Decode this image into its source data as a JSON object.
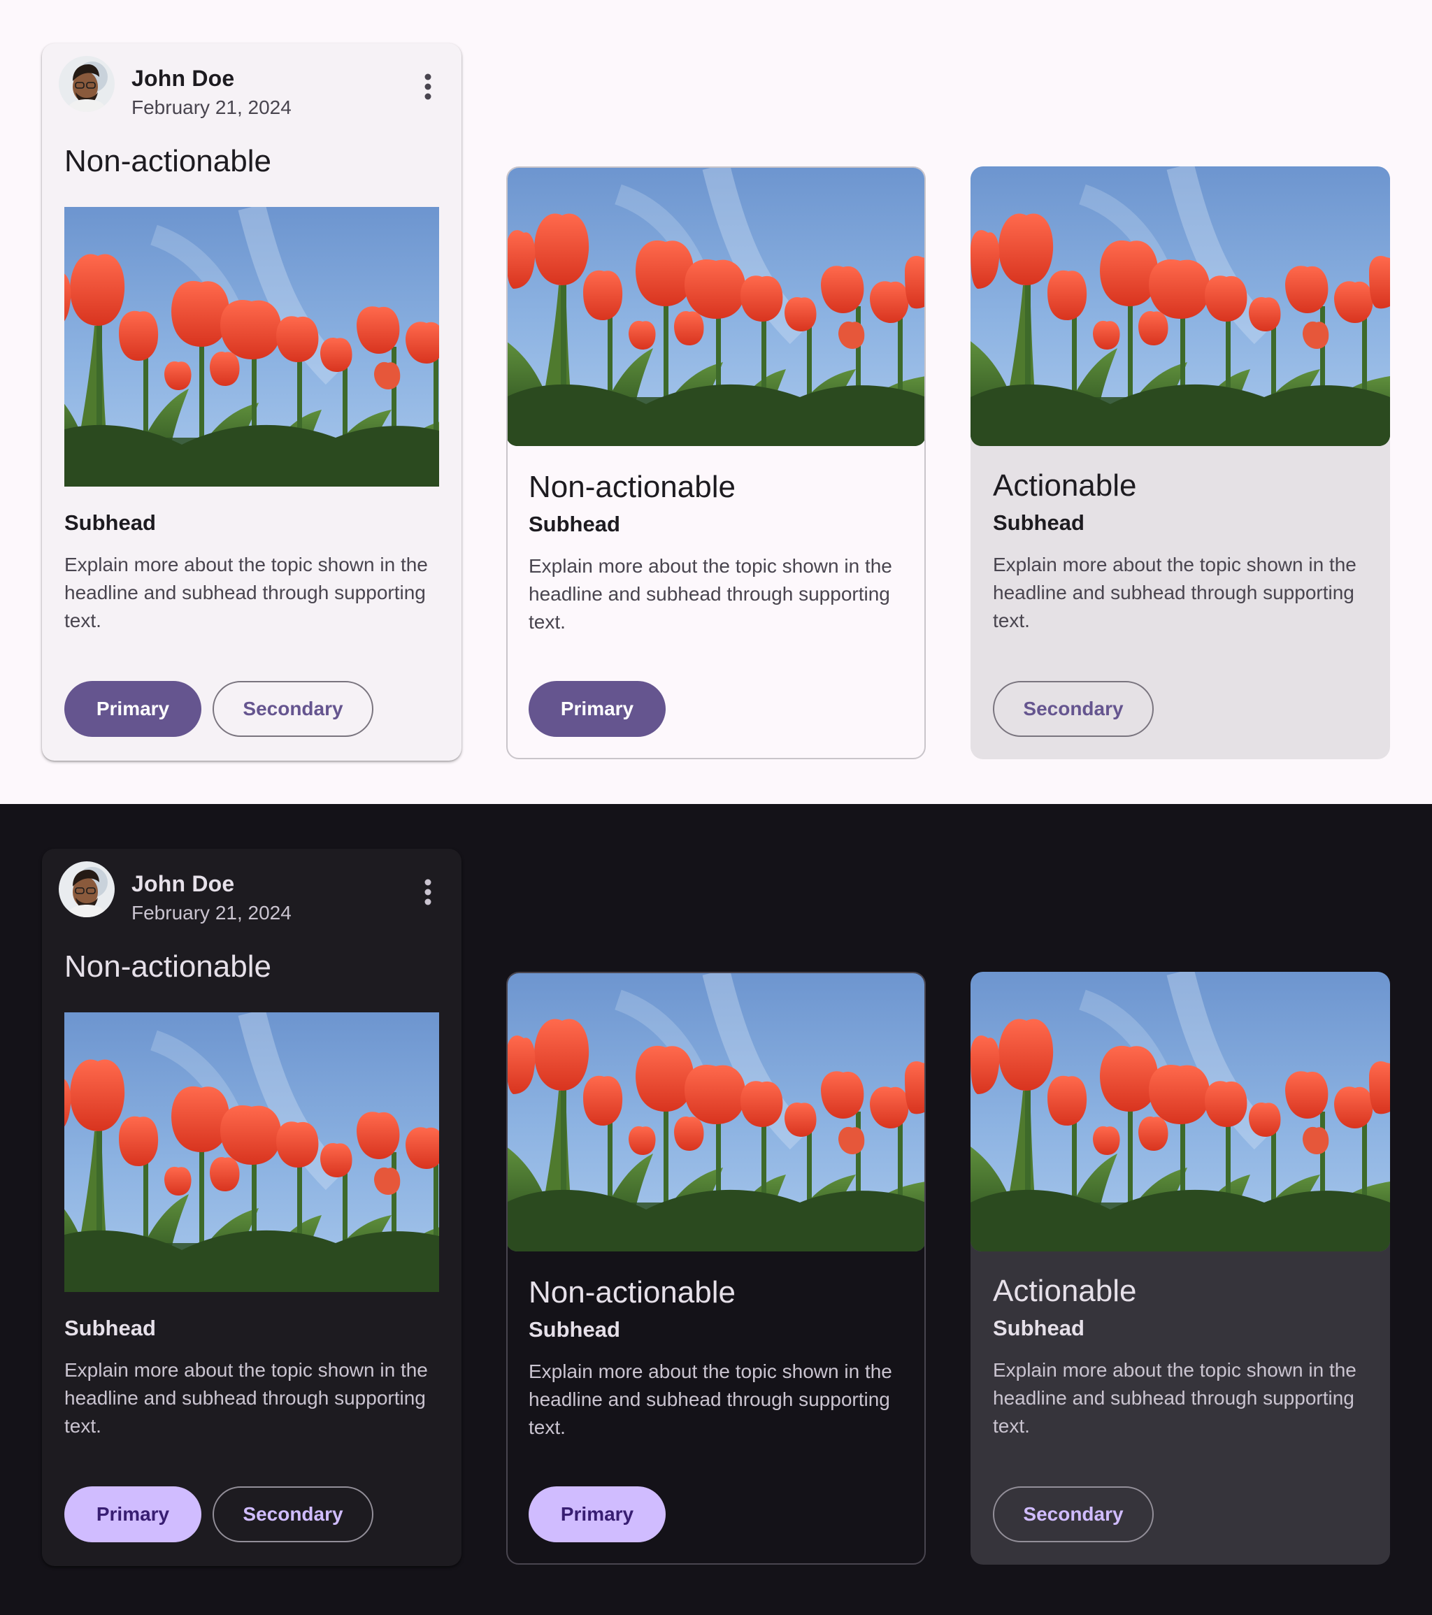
{
  "colors": {
    "light_background": "#fdf8fc",
    "dark_background": "#141218",
    "primary_light": "#65558f",
    "primary_dark": "#d0bcff"
  },
  "themes": [
    {
      "theme": "light",
      "elevated": {
        "author": "John Doe",
        "date": "February 21, 2024",
        "more_icon": "more-vert-icon",
        "headline": "Non-actionable",
        "subhead": "Subhead",
        "supporting": "Explain more about the topic shown in the headline and subhead through supporting text.",
        "primary": "Primary",
        "secondary": "Secondary"
      },
      "outlined": {
        "headline": "Non-actionable",
        "subhead": "Subhead",
        "supporting": "Explain more about the topic shown in the headline and subhead through supporting text.",
        "primary": "Primary"
      },
      "filled": {
        "headline": "Actionable",
        "subhead": "Subhead",
        "supporting": "Explain more about the topic shown in the headline and subhead through supporting text.",
        "secondary": "Secondary"
      }
    },
    {
      "theme": "dark",
      "elevated": {
        "author": "John Doe",
        "date": "February 21, 2024",
        "more_icon": "more-vert-icon",
        "headline": "Non-actionable",
        "subhead": "Subhead",
        "supporting": "Explain more about the topic shown in the headline and subhead through supporting text.",
        "primary": "Primary",
        "secondary": "Secondary"
      },
      "outlined": {
        "headline": "Non-actionable",
        "subhead": "Subhead",
        "supporting": "Explain more about the topic shown in the headline and subhead through supporting text.",
        "primary": "Primary"
      },
      "filled": {
        "headline": "Actionable",
        "subhead": "Subhead",
        "supporting": "Explain more about the topic shown in the headline and subhead through supporting text.",
        "secondary": "Secondary"
      }
    }
  ]
}
